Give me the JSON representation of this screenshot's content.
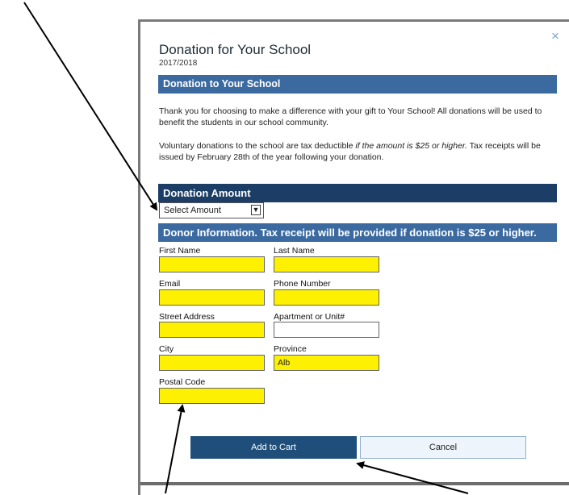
{
  "dialog": {
    "title": "Donation for Your School",
    "year": "2017/2018",
    "close_icon": "×"
  },
  "section_donation": {
    "header": "Donation to Your School",
    "paragraph_1": "Thank you for choosing to make a difference with your gift to Your School!  All donations will be used to benefit the students in our school community.",
    "paragraph_2_prefix": "Voluntary donations to the school are tax deductible ",
    "paragraph_2_emphasis": "if the amount is $25 or higher.",
    "paragraph_2_suffix": "  Tax receipts will be issued by February 28th of the year following your donation."
  },
  "section_amount": {
    "header": "Donation Amount",
    "select_value": "Select Amount"
  },
  "section_donor": {
    "header": "Donor Information. Tax receipt will be provided if donation is $25 or higher.",
    "fields": {
      "first_name": {
        "label": "First Name",
        "value": ""
      },
      "last_name": {
        "label": "Last Name",
        "value": ""
      },
      "email": {
        "label": "Email",
        "value": ""
      },
      "phone": {
        "label": "Phone Number",
        "value": ""
      },
      "street": {
        "label": "Street Address",
        "value": ""
      },
      "apartment": {
        "label": "Apartment or Unit#",
        "value": ""
      },
      "city": {
        "label": "City",
        "value": ""
      },
      "province": {
        "label": "Province",
        "value": "Alb"
      },
      "postal": {
        "label": "Postal Code",
        "value": ""
      }
    }
  },
  "buttons": {
    "add_to_cart": "Add to Cart",
    "cancel": "Cancel"
  },
  "colors": {
    "header_blue": "#3b6aa0",
    "header_dark": "#1b3d66",
    "highlight": "#fdf000",
    "primary_button": "#1f4e7a"
  }
}
